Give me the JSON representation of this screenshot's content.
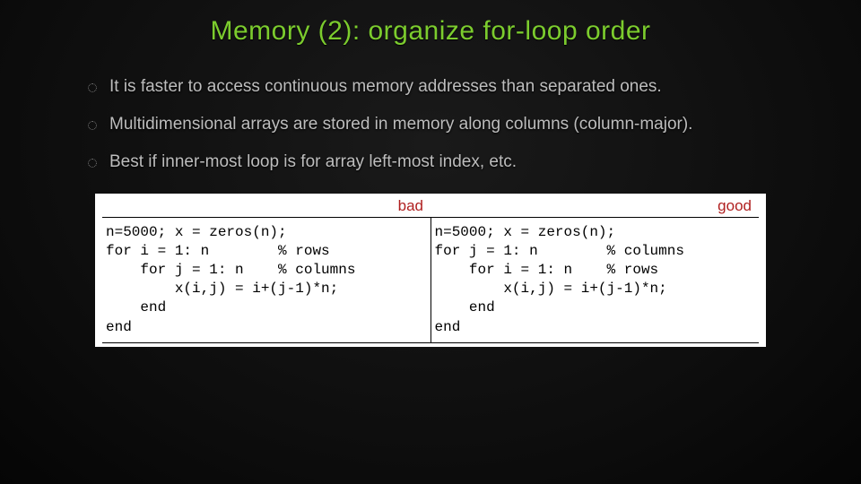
{
  "title": "Memory (2): organize for-loop order",
  "bullets": [
    "It is faster to access continuous memory addresses than separated ones.",
    "Multidimensional arrays are stored in memory along columns (column-major).",
    "Best if inner-most loop is for array left-most index, etc."
  ],
  "labels": {
    "bad": "bad",
    "good": "good"
  },
  "code": {
    "bad": "n=5000; x = zeros(n);\nfor i = 1: n        % rows\n    for j = 1: n    % columns\n        x(i,j) = i+(j-1)*n;\n    end\nend",
    "good": "n=5000; x = zeros(n);\nfor j = 1: n        % columns\n    for i = 1: n    % rows\n        x(i,j) = i+(j-1)*n;\n    end\nend"
  }
}
